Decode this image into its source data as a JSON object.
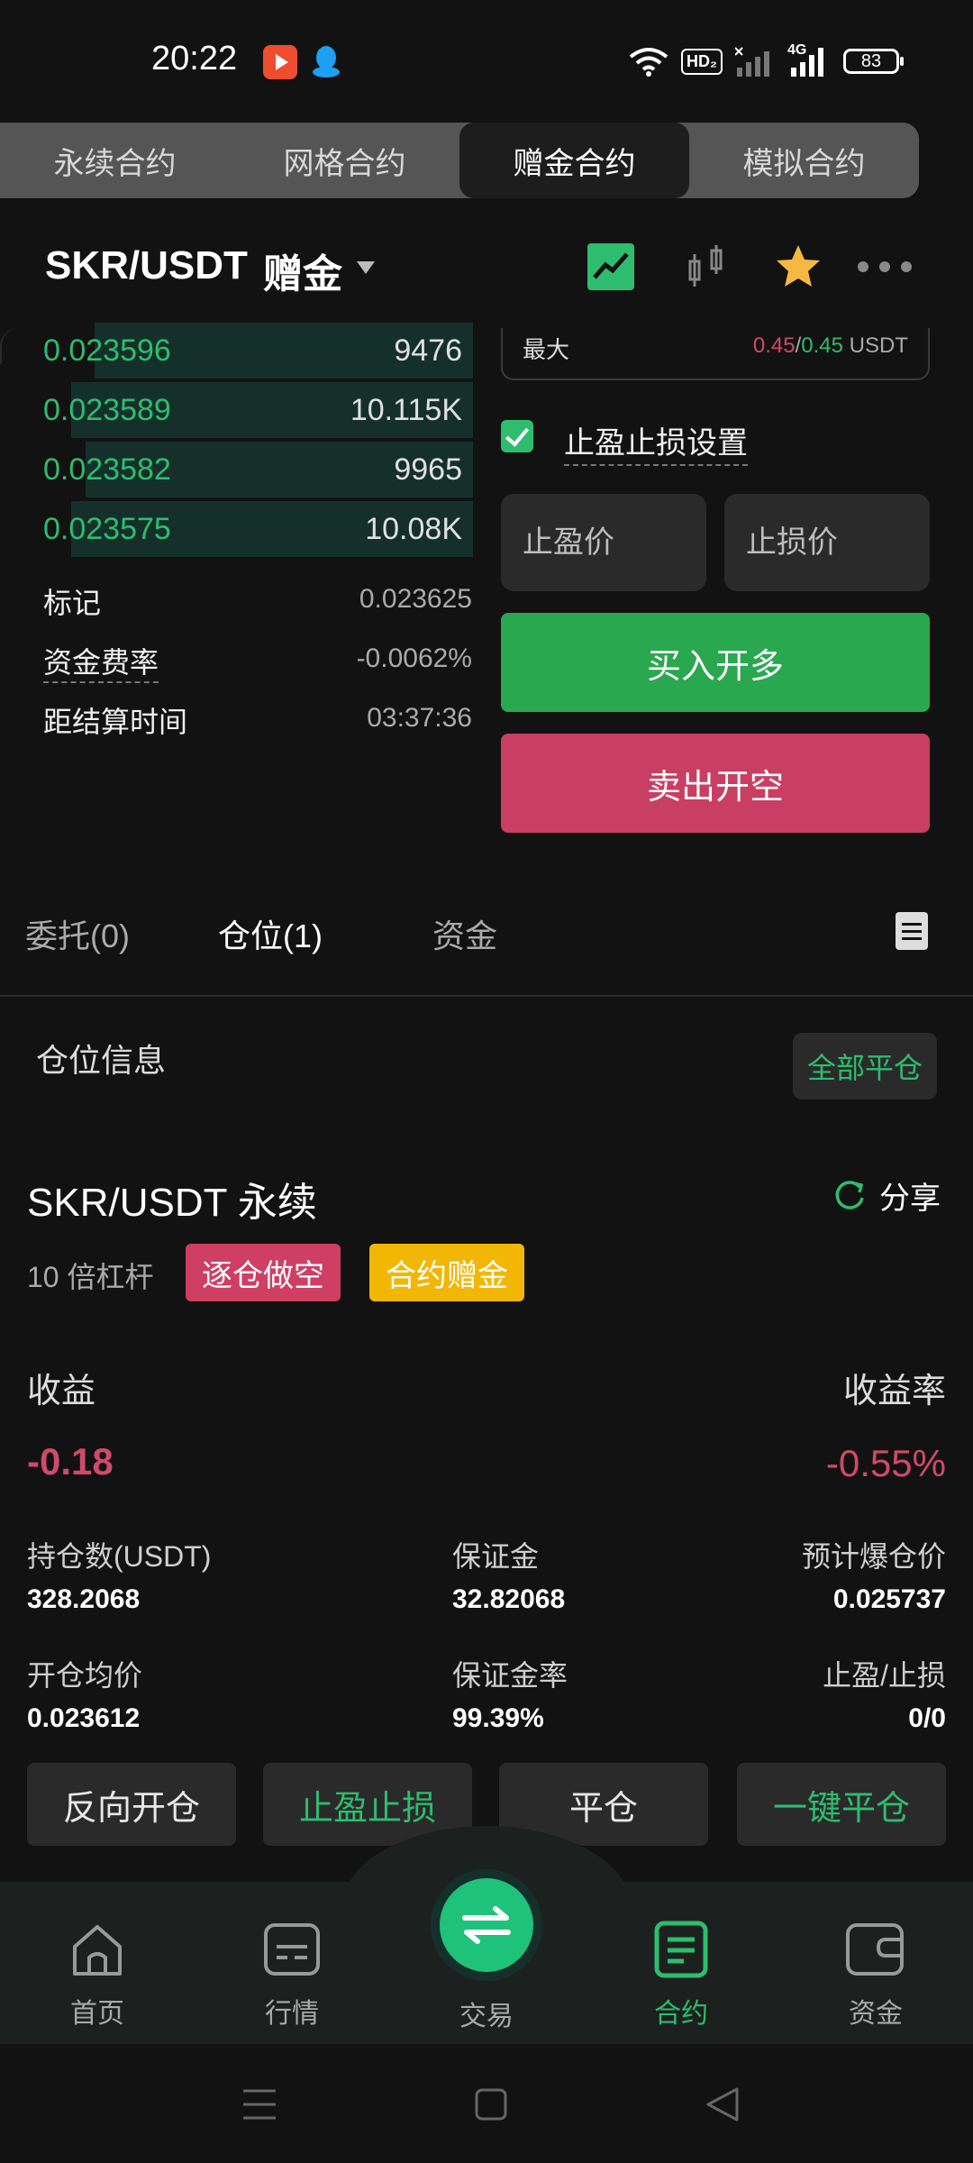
{
  "status_bar": {
    "time": "20:22",
    "hd": "HD₂",
    "network": "4G",
    "battery": "83"
  },
  "top_tabs": [
    {
      "label": "永续合约",
      "active": false
    },
    {
      "label": "网格合约",
      "active": false
    },
    {
      "label": "赠金合约",
      "active": true
    },
    {
      "label": "模拟合约",
      "active": false
    }
  ],
  "header": {
    "pair": "SKR/USDT",
    "subtitle": "赠金"
  },
  "order_book": [
    {
      "price": "0.023596",
      "qty": "9476",
      "depth": 0.8
    },
    {
      "price": "0.023589",
      "qty": "10.115K",
      "depth": 0.85
    },
    {
      "price": "0.023582",
      "qty": "9965",
      "depth": 0.82
    },
    {
      "price": "0.023575",
      "qty": "10.08K",
      "depth": 0.85
    }
  ],
  "market_stats": {
    "mark_label": "标记",
    "mark_value": "0.023625",
    "funding_label": "资金费率",
    "funding_value": "-0.0062%",
    "settle_label": "距结算时间",
    "settle_value": "03:37:36"
  },
  "order_form": {
    "max_label": "最大",
    "max_value_a": "0.45",
    "max_sep": "/",
    "max_value_b": "0.45",
    "max_unit": "USDT",
    "tpsl_label": "止盈止损设置",
    "tp_placeholder": "止盈价",
    "sl_placeholder": "止损价",
    "buy_label": "买入开多",
    "sell_label": "卖出开空"
  },
  "section_tabs": [
    {
      "label": "委托(0)",
      "active": false
    },
    {
      "label": "仓位(1)",
      "active": true
    },
    {
      "label": "资金",
      "active": false
    }
  ],
  "position": {
    "section_title": "仓位信息",
    "close_all": "全部平仓",
    "title": "SKR/USDT 永续",
    "share": "分享",
    "leverage": "10 倍杠杆",
    "badge_mode": "逐仓做空",
    "badge_bonus": "合约赠金",
    "pnl_label": "收益",
    "pnl_value": "-0.18",
    "pnl_rate_label": "收益率",
    "pnl_rate_value": "-0.55%",
    "size_label": "持仓数(USDT)",
    "size_value": "328.2068",
    "margin_label": "保证金",
    "margin_value": "32.82068",
    "liq_label": "预计爆仓价",
    "liq_value": "0.025737",
    "entry_label": "开仓均价",
    "entry_value": "0.023612",
    "margin_ratio_label": "保证金率",
    "margin_ratio_value": "99.39%",
    "tpsl_label": "止盈/止损",
    "tpsl_value": "0/0"
  },
  "actions": [
    "反向开仓",
    "止盈止损",
    "平仓",
    "一键平仓"
  ],
  "bottom_nav": [
    {
      "label": "首页",
      "icon": "home-icon"
    },
    {
      "label": "行情",
      "icon": "market-icon"
    },
    {
      "label": "交易",
      "icon": "swap-icon"
    },
    {
      "label": "合约",
      "icon": "contract-icon",
      "active": true
    },
    {
      "label": "资金",
      "icon": "wallet-icon"
    }
  ],
  "colors": {
    "green": "#2ebd6e",
    "red": "#cf4a6b",
    "gold": "#f2b705",
    "bg": "#121212"
  }
}
